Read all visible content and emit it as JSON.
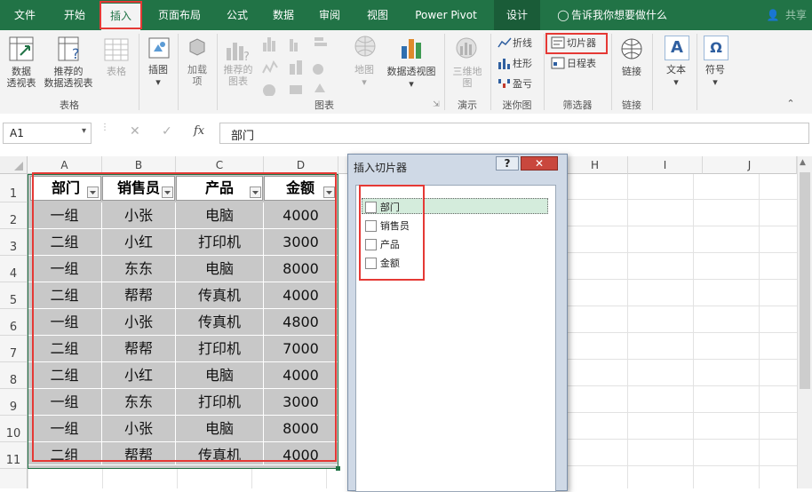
{
  "tabs": [
    "文件",
    "开始",
    "插入",
    "页面布局",
    "公式",
    "数据",
    "审阅",
    "视图",
    "Power Pivot",
    "设计"
  ],
  "tell_me": "告诉我你想要做什么",
  "share": "共享",
  "ribbon": {
    "pivot_table": "数据\n透视表",
    "recommended_pivot": "推荐的\n数据透视表",
    "table": "表格",
    "group_tables": "表格",
    "illustrations": "插图",
    "addins": "加载\n项",
    "recommended_charts": "推荐的\n图表",
    "maps": "地图",
    "pivot_chart": "数据透视图",
    "group_charts": "图表",
    "3d_map": "三维地\n图",
    "group_tours": "演示",
    "spark_line": "折线",
    "spark_column": "柱形",
    "spark_winloss": "盈亏",
    "group_sparklines": "迷你图",
    "slicer": "切片器",
    "timeline": "日程表",
    "group_filters": "筛选器",
    "link": "链接",
    "group_links": "链接",
    "text": "文本",
    "symbol": "符号"
  },
  "formula_bar": {
    "name_box": "A1",
    "fx": "fx",
    "content": "部门"
  },
  "columns": [
    "A",
    "B",
    "C",
    "D",
    "",
    "",
    "",
    "H",
    "I",
    "J"
  ],
  "rows": [
    "1",
    "2",
    "3",
    "4",
    "5",
    "6",
    "7",
    "8",
    "9",
    "10",
    "11"
  ],
  "table": {
    "headers": [
      "部门",
      "销售员",
      "产品",
      "金额"
    ],
    "rows": [
      [
        "一组",
        "小张",
        "电脑",
        "4000"
      ],
      [
        "二组",
        "小红",
        "打印机",
        "3000"
      ],
      [
        "一组",
        "东东",
        "电脑",
        "8000"
      ],
      [
        "二组",
        "帮帮",
        "传真机",
        "4000"
      ],
      [
        "一组",
        "小张",
        "传真机",
        "4800"
      ],
      [
        "二组",
        "帮帮",
        "打印机",
        "7000"
      ],
      [
        "二组",
        "小红",
        "电脑",
        "4000"
      ],
      [
        "一组",
        "东东",
        "打印机",
        "3000"
      ],
      [
        "一组",
        "小张",
        "电脑",
        "8000"
      ],
      [
        "二组",
        "帮帮",
        "传真机",
        "4000"
      ]
    ]
  },
  "dialog": {
    "title": "插入切片器",
    "help": "?",
    "fields": [
      "部门",
      "销售员",
      "产品",
      "金额"
    ]
  }
}
